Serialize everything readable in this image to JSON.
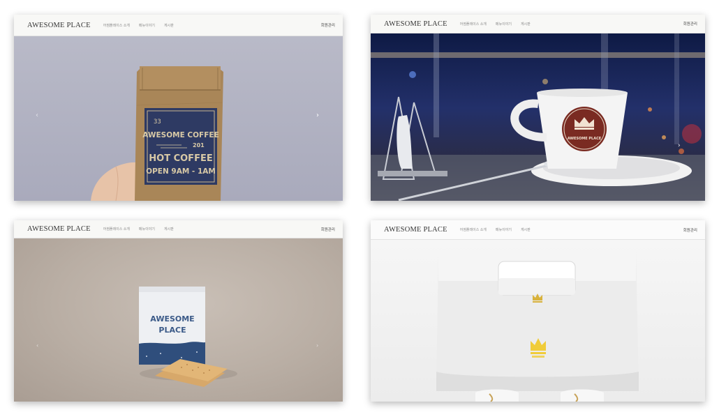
{
  "panels": [
    {
      "brand": "AWESOME PLACE",
      "menu": [
        "어썸플레이스 소개",
        "메뉴이야기",
        "게시판"
      ],
      "admin": "회원관리",
      "hero": {
        "label_top": "33",
        "label_main": "AWESOME COFFEE",
        "label_num": "201",
        "label_hot": "HOT COFFEE",
        "label_hours": "OPEN 9AM - 1AM"
      }
    },
    {
      "brand": "AWESOME PLACE",
      "menu": [
        "어썸플레이스 소개",
        "메뉴이야기",
        "게시판"
      ],
      "admin": "회원관리",
      "hero": {
        "cup_logo": "AWESOME PLACE"
      }
    },
    {
      "brand": "AWESOME PLACE",
      "menu": [
        "어썸플레이스 소개",
        "메뉴이야기",
        "게시판"
      ],
      "admin": "회원관리",
      "hero": {
        "pouch_line1": "AWESOME",
        "pouch_line2": "PLACE"
      }
    },
    {
      "brand": "AWESOME PLACE",
      "menu": [
        "어썸플레이스 소개",
        "메뉴이야기",
        "게시판"
      ],
      "admin": "회원관리",
      "hero": {}
    }
  ],
  "icons": {
    "prev": "chevron-left-icon",
    "next": "chevron-right-icon",
    "crown": "crown-icon"
  },
  "colors": {
    "navy": "#2e3a63",
    "kraft": "#9a7b4f",
    "cup_red": "#7a2b22",
    "gold": "#d8b23c"
  }
}
